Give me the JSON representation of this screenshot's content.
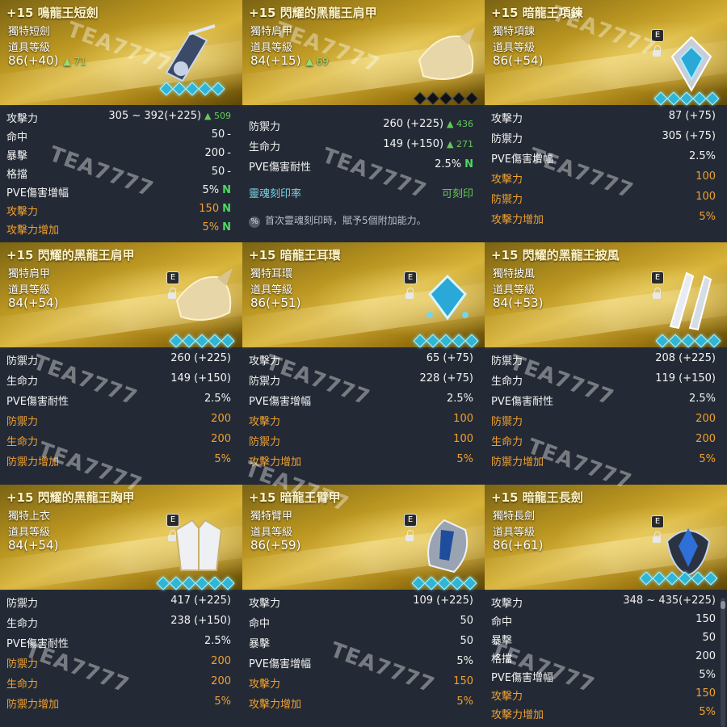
{
  "watermark": "TEA7777",
  "cards": [
    {
      "title": "+15 鳴龍王短劍",
      "type": "獨特短劍",
      "level_label": "道具等級",
      "level_value": "86(+40)",
      "level_gain": "▲ 71",
      "gem_count": 5,
      "stats": [
        {
          "k": "攻擊力",
          "v": "305 ~ 392(+225)",
          "g": "▲ 509",
          "color": "white"
        },
        {
          "k": "命中",
          "v": "50",
          "suffix": "-",
          "color": "white"
        },
        {
          "k": "暴擊",
          "v": "200",
          "suffix": "-",
          "color": "white"
        },
        {
          "k": "格擋",
          "v": "50",
          "suffix": "-",
          "color": "white"
        },
        {
          "k": "PVE傷害增幅",
          "v": "5%",
          "n": "N",
          "color": "white"
        },
        {
          "k": "攻擊力",
          "v": "150",
          "n": "N",
          "color": "orange"
        },
        {
          "k": "攻擊力增加",
          "v": "5%",
          "n": "N",
          "color": "orange"
        }
      ]
    },
    {
      "title": "+15 閃耀的黑龍王肩甲",
      "type": "獨特肩甲",
      "level_label": "道具等級",
      "level_value": "84(+15)",
      "level_gain": "▲ 69",
      "gem_count": 5,
      "gems_dark": true,
      "stats": [
        {
          "k": "防禦力",
          "v": "260 (+225)",
          "g": "▲ 436",
          "color": "white"
        },
        {
          "k": "生命力",
          "v": "149 (+150)",
          "g": "▲ 271",
          "color": "white"
        },
        {
          "k": "PVE傷害耐性",
          "v": "2.5%",
          "n": "N",
          "color": "white"
        },
        {
          "k": "靈魂刻印率",
          "v": "可刻印",
          "color": "teal"
        }
      ],
      "notice_icon": "%",
      "notice": "首次靈魂刻印時，賦予5個附加能力。"
    },
    {
      "title": "+15 暗龍王項鍊",
      "type": "獨特項鍊",
      "level_label": "道具等級",
      "level_value": "86(+54)",
      "badge": "E",
      "gem_count": 5,
      "stats": [
        {
          "k": "攻擊力",
          "v": "87 (+75)",
          "color": "white"
        },
        {
          "k": "防禦力",
          "v": "305 (+75)",
          "color": "white"
        },
        {
          "k": "PVE傷害增幅",
          "v": "2.5%",
          "color": "white"
        },
        {
          "k": "攻擊力",
          "v": "100",
          "color": "orange"
        },
        {
          "k": "防禦力",
          "v": "100",
          "color": "orange"
        },
        {
          "k": "攻擊力增加",
          "v": "5%",
          "color": "orange"
        }
      ]
    },
    {
      "title": "+15 閃耀的黑龍王肩甲",
      "type": "獨特肩甲",
      "level_label": "道具等級",
      "level_value": "84(+54)",
      "badge": "E",
      "gem_count": 5,
      "stats": [
        {
          "k": "防禦力",
          "v": "260 (+225)",
          "color": "white"
        },
        {
          "k": "生命力",
          "v": "149 (+150)",
          "color": "white"
        },
        {
          "k": "PVE傷害耐性",
          "v": "2.5%",
          "color": "white"
        },
        {
          "k": "防禦力",
          "v": "200",
          "color": "orange"
        },
        {
          "k": "生命力",
          "v": "200",
          "color": "orange"
        },
        {
          "k": "防禦力增加",
          "v": "5%",
          "color": "orange"
        }
      ]
    },
    {
      "title": "+15 暗龍王耳環",
      "type": "獨特耳環",
      "level_label": "道具等級",
      "level_value": "86(+51)",
      "badge": "E",
      "gem_count": 5,
      "stats": [
        {
          "k": "攻擊力",
          "v": "65 (+75)",
          "color": "white"
        },
        {
          "k": "防禦力",
          "v": "228 (+75)",
          "color": "white"
        },
        {
          "k": "PVE傷害增幅",
          "v": "2.5%",
          "color": "white"
        },
        {
          "k": "攻擊力",
          "v": "100",
          "color": "orange"
        },
        {
          "k": "防禦力",
          "v": "100",
          "color": "orange"
        },
        {
          "k": "攻擊力增加",
          "v": "5%",
          "color": "orange"
        }
      ]
    },
    {
      "title": "+15 閃耀的黑龍王披風",
      "type": "獨特披風",
      "level_label": "道具等級",
      "level_value": "84(+53)",
      "badge": "E",
      "gem_count": 5,
      "stats": [
        {
          "k": "防禦力",
          "v": "208 (+225)",
          "color": "white"
        },
        {
          "k": "生命力",
          "v": "119 (+150)",
          "color": "white"
        },
        {
          "k": "PVE傷害耐性",
          "v": "2.5%",
          "color": "white"
        },
        {
          "k": "防禦力",
          "v": "200",
          "color": "orange"
        },
        {
          "k": "生命力",
          "v": "200",
          "color": "orange"
        },
        {
          "k": "防禦力增加",
          "v": "5%",
          "color": "orange"
        }
      ]
    },
    {
      "title": "+15 閃耀的黑龍王胸甲",
      "type": "獨特上衣",
      "level_label": "道具等級",
      "level_value": "84(+54)",
      "badge": "E",
      "gem_count": 6,
      "stats": [
        {
          "k": "防禦力",
          "v": "417 (+225)",
          "color": "white"
        },
        {
          "k": "生命力",
          "v": "238 (+150)",
          "color": "white"
        },
        {
          "k": "PVE傷害耐性",
          "v": "2.5%",
          "color": "white"
        },
        {
          "k": "防禦力",
          "v": "200",
          "color": "orange"
        },
        {
          "k": "生命力",
          "v": "200",
          "color": "orange"
        },
        {
          "k": "防禦力增加",
          "v": "5%",
          "color": "orange"
        }
      ]
    },
    {
      "title": "+15 暗龍王臂甲",
      "type": "獨特臂甲",
      "level_label": "道具等級",
      "level_value": "86(+59)",
      "badge": "E",
      "gem_count": 5,
      "stats": [
        {
          "k": "攻擊力",
          "v": "109 (+225)",
          "color": "white"
        },
        {
          "k": "命中",
          "v": "50",
          "color": "white"
        },
        {
          "k": "暴擊",
          "v": "50",
          "color": "white"
        },
        {
          "k": "PVE傷害增幅",
          "v": "5%",
          "color": "white"
        },
        {
          "k": "攻擊力",
          "v": "150",
          "color": "orange"
        },
        {
          "k": "攻擊力增加",
          "v": "5%",
          "color": "orange"
        }
      ]
    },
    {
      "title": "+15 暗龍王長劍",
      "type": "獨特長劍",
      "level_label": "道具等級",
      "level_value": "86(+61)",
      "badge": "E",
      "gem_count": 6,
      "stats": [
        {
          "k": "攻擊力",
          "v": "348 ~ 435(+225)",
          "color": "white"
        },
        {
          "k": "命中",
          "v": "150",
          "color": "white"
        },
        {
          "k": "暴擊",
          "v": "50",
          "color": "white"
        },
        {
          "k": "格擋",
          "v": "200",
          "color": "white"
        },
        {
          "k": "PVE傷害增幅",
          "v": "5%",
          "color": "white"
        },
        {
          "k": "攻擊力",
          "v": "150",
          "color": "orange"
        },
        {
          "k": "攻擊力增加",
          "v": "5%",
          "color": "orange"
        }
      ]
    }
  ]
}
